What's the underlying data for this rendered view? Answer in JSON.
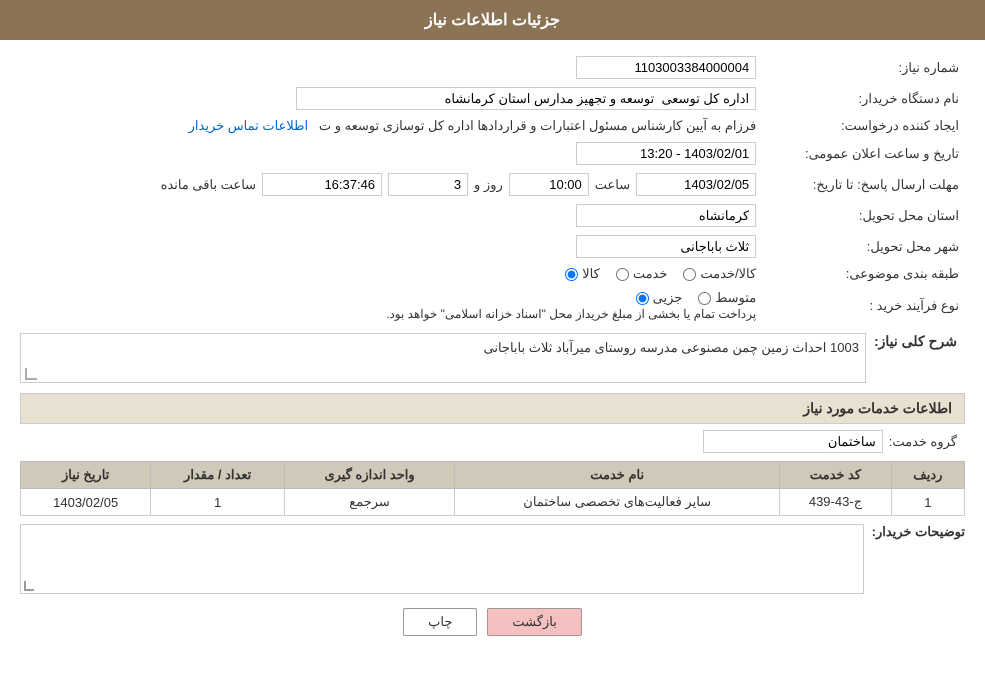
{
  "header": {
    "title": "جزئیات اطلاعات نیاز"
  },
  "fields": {
    "request_number_label": "شماره نیاز:",
    "request_number_value": "1103003384000004",
    "buyer_org_label": "نام دستگاه خریدار:",
    "buyer_org_value": "اداره کل توسعی  توسعه و تجهیز مدارس استان کرمانشاه",
    "created_by_label": "ایجاد کننده درخواست:",
    "created_by_value": "فرزام به آیین کارشناس مسئول اعتبارات و قراردادها اداره کل توسازی  توسعه و ت",
    "created_by_link": "اطلاعات تماس خریدار",
    "announce_date_label": "تاریخ و ساعت اعلان عمومی:",
    "announce_date_value": "1403/02/01 - 13:20",
    "reply_deadline_label": "مهلت ارسال پاسخ: تا تاریخ:",
    "reply_date": "1403/02/05",
    "reply_time": "10:00",
    "reply_days": "3",
    "reply_timer": "16:37:46",
    "reply_timer_label": "ساعت باقی مانده",
    "delivery_province_label": "استان محل تحویل:",
    "delivery_province_value": "کرمانشاه",
    "delivery_city_label": "شهر محل تحویل:",
    "delivery_city_value": "ثلاث باباجانی",
    "category_label": "طبقه بندی موضوعی:",
    "category_options": [
      "کالا",
      "خدمت",
      "کالا/خدمت"
    ],
    "category_selected": "کالا",
    "purchase_type_label": "نوع فرآیند خرید :",
    "purchase_type_options": [
      "جزیی",
      "متوسط"
    ],
    "purchase_type_note": "پرداخت تمام یا بخشی از مبلغ خریداز محل \"اسناد خزانه اسلامی\" خواهد بود.",
    "description_label": "شرح کلی نیاز:",
    "description_value": "1003 احداث زمین چمن مصنوعی مدرسه روستای میرآباد ثلاث باباجانی",
    "services_section_label": "اطلاعات خدمات مورد نیاز",
    "service_group_label": "گروه خدمت:",
    "service_group_value": "ساختمان",
    "table": {
      "columns": [
        "ردیف",
        "کد خدمت",
        "نام خدمت",
        "واحد اندازه گیری",
        "تعداد / مقدار",
        "تاریخ نیاز"
      ],
      "rows": [
        {
          "row": "1",
          "code": "ج-43-439",
          "name": "سایر فعالیت‌های تخصصی ساختمان",
          "unit": "سرجمع",
          "quantity": "1",
          "date": "1403/02/05"
        }
      ]
    },
    "buyer_comments_label": "توضیحات خریدار:",
    "buyer_comments_value": ""
  },
  "buttons": {
    "print_label": "چاپ",
    "back_label": "بازگشت"
  }
}
